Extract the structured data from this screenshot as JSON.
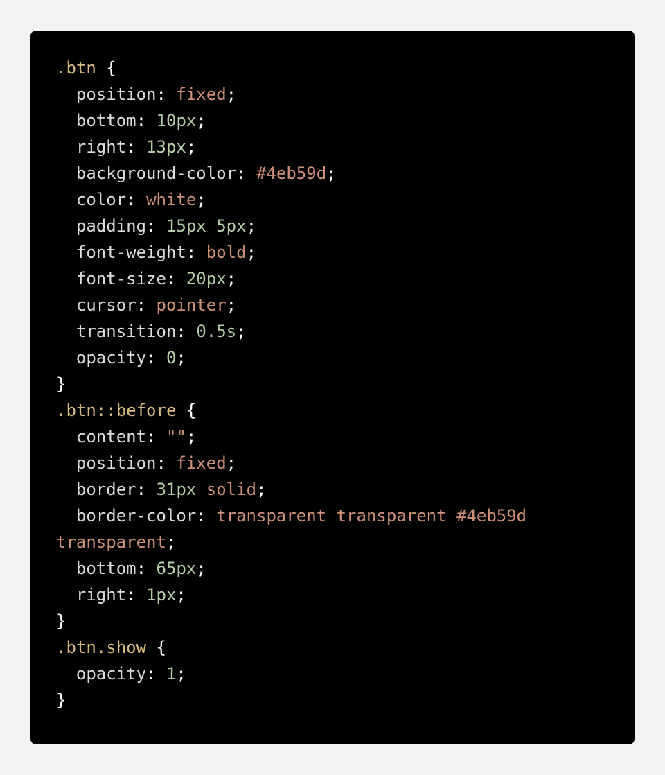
{
  "colors": {
    "background": "#f2f2f2",
    "code_background": "#000000",
    "selector": "#d7ba7d",
    "property": "#dcdcdc",
    "value": "#ce9178",
    "number": "#b5cea8",
    "punctuation": "#ffffff"
  },
  "code": {
    "language": "css",
    "lines": [
      [
        [
          "selector",
          ".btn"
        ],
        [
          "punct",
          " {"
        ]
      ],
      [
        [
          "property",
          "  position"
        ],
        [
          "punct",
          ": "
        ],
        [
          "value",
          "fixed"
        ],
        [
          "punct",
          ";"
        ]
      ],
      [
        [
          "property",
          "  bottom"
        ],
        [
          "punct",
          ": "
        ],
        [
          "number",
          "10px"
        ],
        [
          "punct",
          ";"
        ]
      ],
      [
        [
          "property",
          "  right"
        ],
        [
          "punct",
          ": "
        ],
        [
          "number",
          "13px"
        ],
        [
          "punct",
          ";"
        ]
      ],
      [
        [
          "property",
          "  background-color"
        ],
        [
          "punct",
          ": "
        ],
        [
          "value",
          "#4eb59d"
        ],
        [
          "punct",
          ";"
        ]
      ],
      [
        [
          "property",
          "  color"
        ],
        [
          "punct",
          ": "
        ],
        [
          "value",
          "white"
        ],
        [
          "punct",
          ";"
        ]
      ],
      [
        [
          "property",
          "  padding"
        ],
        [
          "punct",
          ": "
        ],
        [
          "number",
          "15px 5px"
        ],
        [
          "punct",
          ";"
        ]
      ],
      [
        [
          "property",
          "  font-weight"
        ],
        [
          "punct",
          ": "
        ],
        [
          "value",
          "bold"
        ],
        [
          "punct",
          ";"
        ]
      ],
      [
        [
          "property",
          "  font-size"
        ],
        [
          "punct",
          ": "
        ],
        [
          "number",
          "20px"
        ],
        [
          "punct",
          ";"
        ]
      ],
      [
        [
          "property",
          "  cursor"
        ],
        [
          "punct",
          ": "
        ],
        [
          "value",
          "pointer"
        ],
        [
          "punct",
          ";"
        ]
      ],
      [
        [
          "property",
          "  transition"
        ],
        [
          "punct",
          ": "
        ],
        [
          "number",
          "0.5s"
        ],
        [
          "punct",
          ";"
        ]
      ],
      [
        [
          "property",
          "  opacity"
        ],
        [
          "punct",
          ": "
        ],
        [
          "number",
          "0"
        ],
        [
          "punct",
          ";"
        ]
      ],
      [
        [
          "punct",
          "}"
        ]
      ],
      [
        [
          "selector",
          ".btn::before"
        ],
        [
          "punct",
          " {"
        ]
      ],
      [
        [
          "property",
          "  content"
        ],
        [
          "punct",
          ": "
        ],
        [
          "value",
          "\"\""
        ],
        [
          "punct",
          ";"
        ]
      ],
      [
        [
          "property",
          "  position"
        ],
        [
          "punct",
          ": "
        ],
        [
          "value",
          "fixed"
        ],
        [
          "punct",
          ";"
        ]
      ],
      [
        [
          "property",
          "  border"
        ],
        [
          "punct",
          ": "
        ],
        [
          "number",
          "31px"
        ],
        [
          "punct",
          " "
        ],
        [
          "value",
          "solid"
        ],
        [
          "punct",
          ";"
        ]
      ],
      [
        [
          "property",
          "  border-color"
        ],
        [
          "punct",
          ": "
        ],
        [
          "value",
          "transparent transparent #4eb59d transparent"
        ],
        [
          "punct",
          ";"
        ]
      ],
      [
        [
          "property",
          "  bottom"
        ],
        [
          "punct",
          ": "
        ],
        [
          "number",
          "65px"
        ],
        [
          "punct",
          ";"
        ]
      ],
      [
        [
          "property",
          "  right"
        ],
        [
          "punct",
          ": "
        ],
        [
          "number",
          "1px"
        ],
        [
          "punct",
          ";"
        ]
      ],
      [
        [
          "punct",
          "}"
        ]
      ],
      [
        [
          "selector",
          ".btn.show"
        ],
        [
          "punct",
          " {"
        ]
      ],
      [
        [
          "property",
          "  opacity"
        ],
        [
          "punct",
          ": "
        ],
        [
          "number",
          "1"
        ],
        [
          "punct",
          ";"
        ]
      ],
      [
        [
          "punct",
          "}"
        ]
      ]
    ]
  }
}
